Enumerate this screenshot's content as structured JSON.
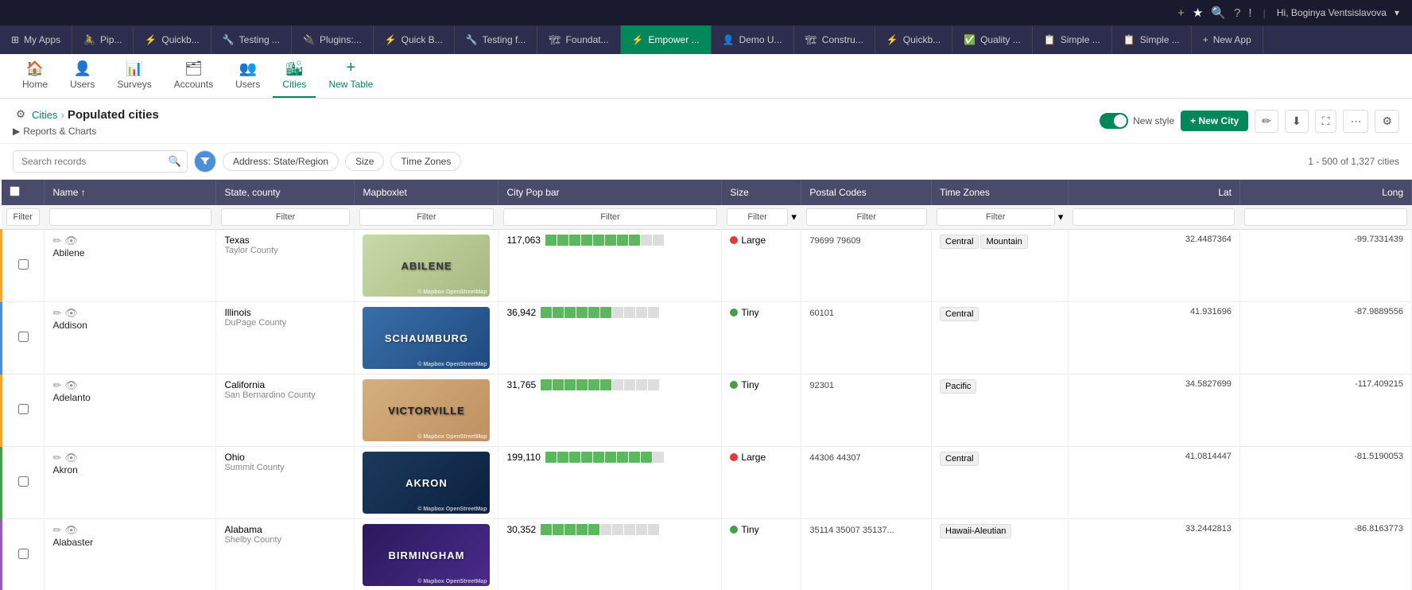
{
  "topNav": {
    "icons": [
      "+",
      "★",
      "🔍",
      "?",
      "!"
    ],
    "separator": "|",
    "userLabel": "Hi, Boginya Ventsislavova",
    "userDropdown": "▾"
  },
  "appTabs": [
    {
      "id": "my-apps",
      "label": "My Apps",
      "icon": "⊞",
      "active": false
    },
    {
      "id": "pip",
      "label": "Pip...",
      "icon": "🚴",
      "active": false
    },
    {
      "id": "quickb1",
      "label": "Quickb...",
      "icon": "⚡",
      "active": false
    },
    {
      "id": "testing1",
      "label": "Testing ...",
      "icon": "🔧",
      "active": false
    },
    {
      "id": "plugins",
      "label": "Plugins:...",
      "icon": "🔌",
      "active": false
    },
    {
      "id": "quickb2",
      "label": "Quick B...",
      "icon": "⚡",
      "active": false
    },
    {
      "id": "testingf",
      "label": "Testing f...",
      "icon": "🔧",
      "active": false
    },
    {
      "id": "foundat",
      "label": "Foundat...",
      "icon": "🏗",
      "active": false
    },
    {
      "id": "empower",
      "label": "Empower ...",
      "icon": "⚡",
      "active": true
    },
    {
      "id": "demou",
      "label": "Demo U...",
      "icon": "👤",
      "active": false
    },
    {
      "id": "constru",
      "label": "Constru...",
      "icon": "🏗",
      "active": false
    },
    {
      "id": "quickb3",
      "label": "Quickb...",
      "icon": "⚡",
      "active": false
    },
    {
      "id": "quality",
      "label": "Quality ...",
      "icon": "✅",
      "active": false
    },
    {
      "id": "simple1",
      "label": "Simple ...",
      "icon": "📋",
      "active": false
    },
    {
      "id": "simple2",
      "label": "Simple ...",
      "icon": "📋",
      "active": false
    },
    {
      "id": "newapp",
      "label": "New App",
      "icon": "+",
      "active": false
    }
  ],
  "secondaryNav": {
    "items": [
      {
        "id": "home",
        "label": "Home",
        "icon": "🏠",
        "active": false
      },
      {
        "id": "users1",
        "label": "Users",
        "icon": "👤",
        "active": false
      },
      {
        "id": "surveys",
        "label": "Surveys",
        "icon": "📊",
        "active": false
      },
      {
        "id": "accounts",
        "label": "Accounts",
        "icon": "🗂",
        "active": false
      },
      {
        "id": "users2",
        "label": "Users",
        "icon": "👥",
        "active": false
      },
      {
        "id": "cities",
        "label": "Cities",
        "icon": "🏙",
        "active": true
      },
      {
        "id": "newtable",
        "label": "New Table",
        "icon": "+",
        "active": false
      }
    ]
  },
  "breadcrumb": {
    "parent": "Cities",
    "current": "Populated cities",
    "reportsLink": "Reports & Charts"
  },
  "toolbar": {
    "newStyleLabel": "New style",
    "newCityLabel": "+ New City",
    "editIcon": "✏",
    "downloadIcon": "⬇",
    "expandIcon": "⛶",
    "moreIcon": "⋯",
    "settingsIcon": "⚙"
  },
  "filterBar": {
    "searchPlaceholder": "Search records",
    "filters": [
      {
        "label": "Address: State/Region"
      },
      {
        "label": "Size"
      },
      {
        "label": "Time Zones"
      }
    ],
    "recordCount": "1 - 500 of 1,327 cities"
  },
  "tableHeaders": [
    {
      "label": "Name ↑",
      "key": "name"
    },
    {
      "label": "State, county",
      "key": "state_county"
    },
    {
      "label": "Mapboxlet",
      "key": "mapboxlet"
    },
    {
      "label": "City Pop bar",
      "key": "city_pop_bar"
    },
    {
      "label": "Size",
      "key": "size"
    },
    {
      "label": "Postal Codes",
      "key": "postal_codes"
    },
    {
      "label": "Time Zones",
      "key": "time_zones"
    },
    {
      "label": "Lat",
      "key": "lat"
    },
    {
      "label": "Long",
      "key": "long"
    }
  ],
  "rows": [
    {
      "name": "Abilene",
      "state": "Texas",
      "county": "Taylor County",
      "mapLabel": "ABILENE",
      "mapStyle": "abilene",
      "population": 117063,
      "popBars": 8,
      "totalBars": 10,
      "size": "Large",
      "sizeDot": "large",
      "postalCodes": "79699 79609",
      "timeZones": [
        "Central",
        "Mountain"
      ],
      "lat": "32.4487364",
      "long": "-99.7331439",
      "stripe": "yellow"
    },
    {
      "name": "Addison",
      "state": "Illinois",
      "county": "DuPage County",
      "mapLabel": "SCHAUMBURG",
      "mapStyle": "addison",
      "population": 36942,
      "popBars": 6,
      "totalBars": 10,
      "size": "Tiny",
      "sizeDot": "tiny",
      "postalCodes": "60101",
      "timeZones": [
        "Central"
      ],
      "lat": "41.931696",
      "long": "-87.9889556",
      "stripe": "blue"
    },
    {
      "name": "Adelanto",
      "state": "California",
      "county": "San Bernardino County",
      "mapLabel": "VICTORVILLE",
      "mapStyle": "adelanto",
      "population": 31765,
      "popBars": 6,
      "totalBars": 10,
      "size": "Tiny",
      "sizeDot": "tiny",
      "postalCodes": "92301",
      "timeZones": [
        "Pacific"
      ],
      "lat": "34.5827699",
      "long": "-117.409215",
      "stripe": "orange"
    },
    {
      "name": "Akron",
      "state": "Ohio",
      "county": "Summit County",
      "mapLabel": "AKRON",
      "mapStyle": "akron",
      "population": 199110,
      "popBars": 9,
      "totalBars": 10,
      "size": "Large",
      "sizeDot": "large",
      "postalCodes": "44306 44307",
      "timeZones": [
        "Central"
      ],
      "lat": "41.0814447",
      "long": "-81.5190053",
      "stripe": "green"
    },
    {
      "name": "Alabaster",
      "state": "Alabama",
      "county": "Shelby County",
      "mapLabel": "BIRMINGHAM",
      "mapStyle": "alabaster",
      "population": 30352,
      "popBars": 5,
      "totalBars": 10,
      "size": "Tiny",
      "sizeDot": "tiny",
      "postalCodes": "35114 35007 35137...",
      "timeZones": [
        "Hawaii-Aleutian"
      ],
      "lat": "33.2442813",
      "long": "-86.8163773",
      "stripe": "purple"
    }
  ]
}
